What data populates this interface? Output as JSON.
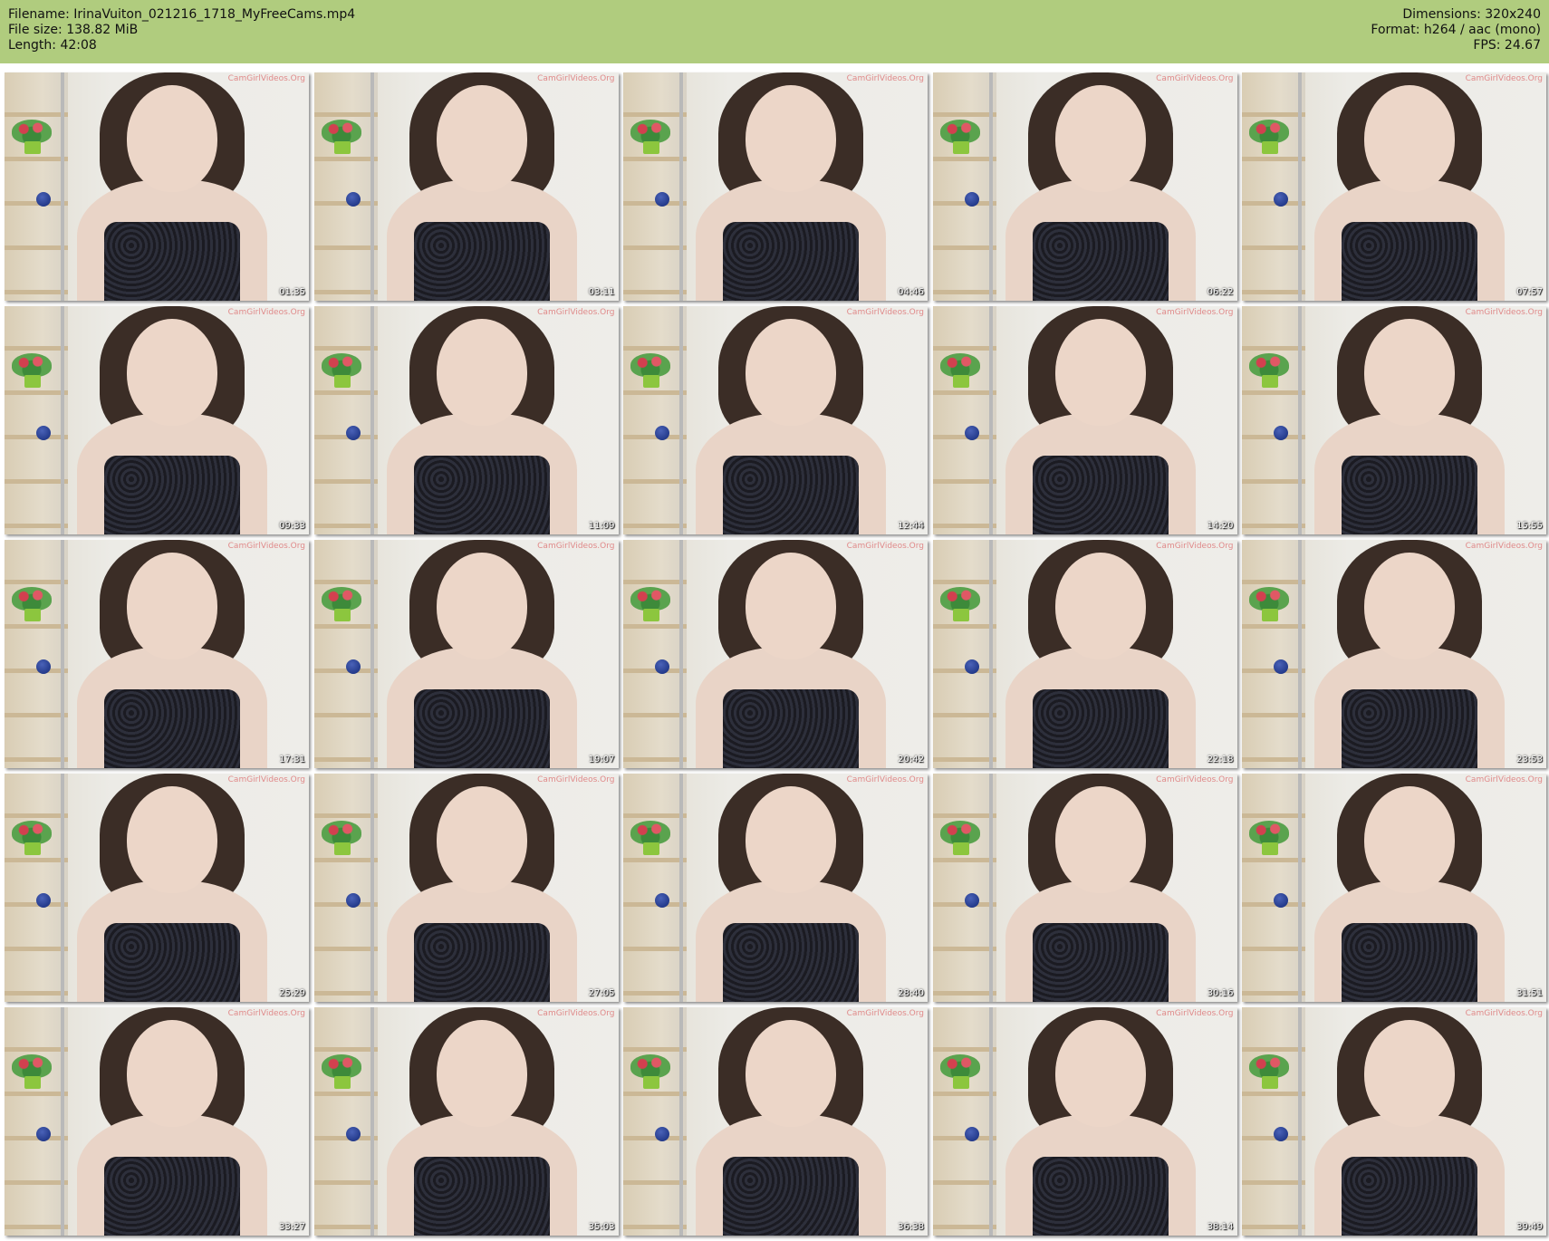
{
  "header": {
    "filename": "Filename: IrinaVuiton_021216_1718_MyFreeCams.mp4",
    "file_size": "File size: 138.82 MiB",
    "length": "Length: 42:08",
    "dimensions": "Dimensions: 320x240",
    "format": "Format: h264 / aac (mono)",
    "fps": "FPS: 24.67"
  },
  "thumbnails": [
    {
      "time": "01:35",
      "watermark": "CamGirlVideos.Org"
    },
    {
      "time": "03:11",
      "watermark": "CamGirlVideos.Org"
    },
    {
      "time": "04:46",
      "watermark": "CamGirlVideos.Org"
    },
    {
      "time": "06:22",
      "watermark": "CamGirlVideos.Org"
    },
    {
      "time": "07:57",
      "watermark": "CamGirlVideos.Org"
    },
    {
      "time": "09:33",
      "watermark": "CamGirlVideos.Org"
    },
    {
      "time": "11:09",
      "watermark": "CamGirlVideos.Org"
    },
    {
      "time": "12:44",
      "watermark": "CamGirlVideos.Org"
    },
    {
      "time": "14:20",
      "watermark": "CamGirlVideos.Org"
    },
    {
      "time": "15:55",
      "watermark": "CamGirlVideos.Org"
    },
    {
      "time": "17:31",
      "watermark": "CamGirlVideos.Org"
    },
    {
      "time": "19:07",
      "watermark": "CamGirlVideos.Org"
    },
    {
      "time": "20:42",
      "watermark": "CamGirlVideos.Org"
    },
    {
      "time": "22:18",
      "watermark": "CamGirlVideos.Org"
    },
    {
      "time": "23:53",
      "watermark": "CamGirlVideos.Org"
    },
    {
      "time": "25:29",
      "watermark": "CamGirlVideos.Org"
    },
    {
      "time": "27:05",
      "watermark": "CamGirlVideos.Org"
    },
    {
      "time": "28:40",
      "watermark": "CamGirlVideos.Org"
    },
    {
      "time": "30:16",
      "watermark": "CamGirlVideos.Org"
    },
    {
      "time": "31:51",
      "watermark": "CamGirlVideos.Org"
    },
    {
      "time": "33:27",
      "watermark": "CamGirlVideos.Org"
    },
    {
      "time": "35:03",
      "watermark": "CamGirlVideos.Org"
    },
    {
      "time": "36:38",
      "watermark": "CamGirlVideos.Org"
    },
    {
      "time": "38:14",
      "watermark": "CamGirlVideos.Org"
    },
    {
      "time": "39:49",
      "watermark": "CamGirlVideos.Org"
    }
  ],
  "colors": {
    "header_background": "#b0cc7e",
    "timestamp_text": "#ffffff"
  }
}
